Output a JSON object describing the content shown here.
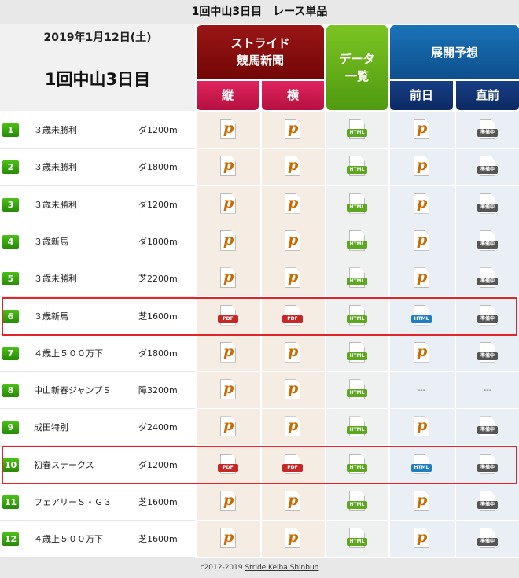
{
  "title": "1回中山3日目　レース単品",
  "info": {
    "date": "2019年1月12日(土)",
    "meet": "1回中山3日目"
  },
  "headers": {
    "stride_line1": "ストライド",
    "stride_line2": "競馬新聞",
    "tate": "縦",
    "yoko": "横",
    "data_line1": "データ",
    "data_line2": "一覧",
    "tenkai": "展開予想",
    "zenjitsu": "前日",
    "chokuzen": "直前"
  },
  "icon_labels": {
    "pdf": "PDF",
    "html": "HTML",
    "junbi": "準備中",
    "dash": "---"
  },
  "races": [
    {
      "num": "1",
      "name": "３歳未勝利",
      "dist": "ダ1200m",
      "stride": "p",
      "zen": "p",
      "choku": "junbi"
    },
    {
      "num": "2",
      "name": "３歳未勝利",
      "dist": "ダ1800m",
      "stride": "p",
      "zen": "p",
      "choku": "junbi"
    },
    {
      "num": "3",
      "name": "３歳未勝利",
      "dist": "ダ1200m",
      "stride": "p",
      "zen": "p",
      "choku": "junbi"
    },
    {
      "num": "4",
      "name": "３歳新馬",
      "dist": "ダ1800m",
      "stride": "p",
      "zen": "p",
      "choku": "junbi"
    },
    {
      "num": "5",
      "name": "３歳未勝利",
      "dist": "芝2200m",
      "stride": "p",
      "zen": "p",
      "choku": "junbi"
    },
    {
      "num": "6",
      "name": "３歳新馬",
      "dist": "芝1600m",
      "stride": "pdf",
      "zen": "html",
      "choku": "junbi"
    },
    {
      "num": "7",
      "name": "４歳上５００万下",
      "dist": "ダ1800m",
      "stride": "p",
      "zen": "p",
      "choku": "junbi"
    },
    {
      "num": "8",
      "name": "中山新春ジャンプＳ",
      "dist": "障3200m",
      "stride": "p",
      "zen": "dash",
      "choku": "dash"
    },
    {
      "num": "9",
      "name": "成田特別",
      "dist": "ダ2400m",
      "stride": "p",
      "zen": "p",
      "choku": "junbi"
    },
    {
      "num": "10",
      "name": "初春ステークス",
      "dist": "ダ1200m",
      "stride": "pdf",
      "zen": "html",
      "choku": "junbi"
    },
    {
      "num": "11",
      "name": "フェアリーＳ・Ｇ３",
      "dist": "芝1600m",
      "stride": "p",
      "zen": "p",
      "choku": "junbi"
    },
    {
      "num": "12",
      "name": "４歳上５００万下",
      "dist": "芝1600m",
      "stride": "p",
      "zen": "p",
      "choku": "junbi"
    }
  ],
  "footer": {
    "copyright": "c2012-2019",
    "link": "Stride Keiba Shinbun"
  }
}
